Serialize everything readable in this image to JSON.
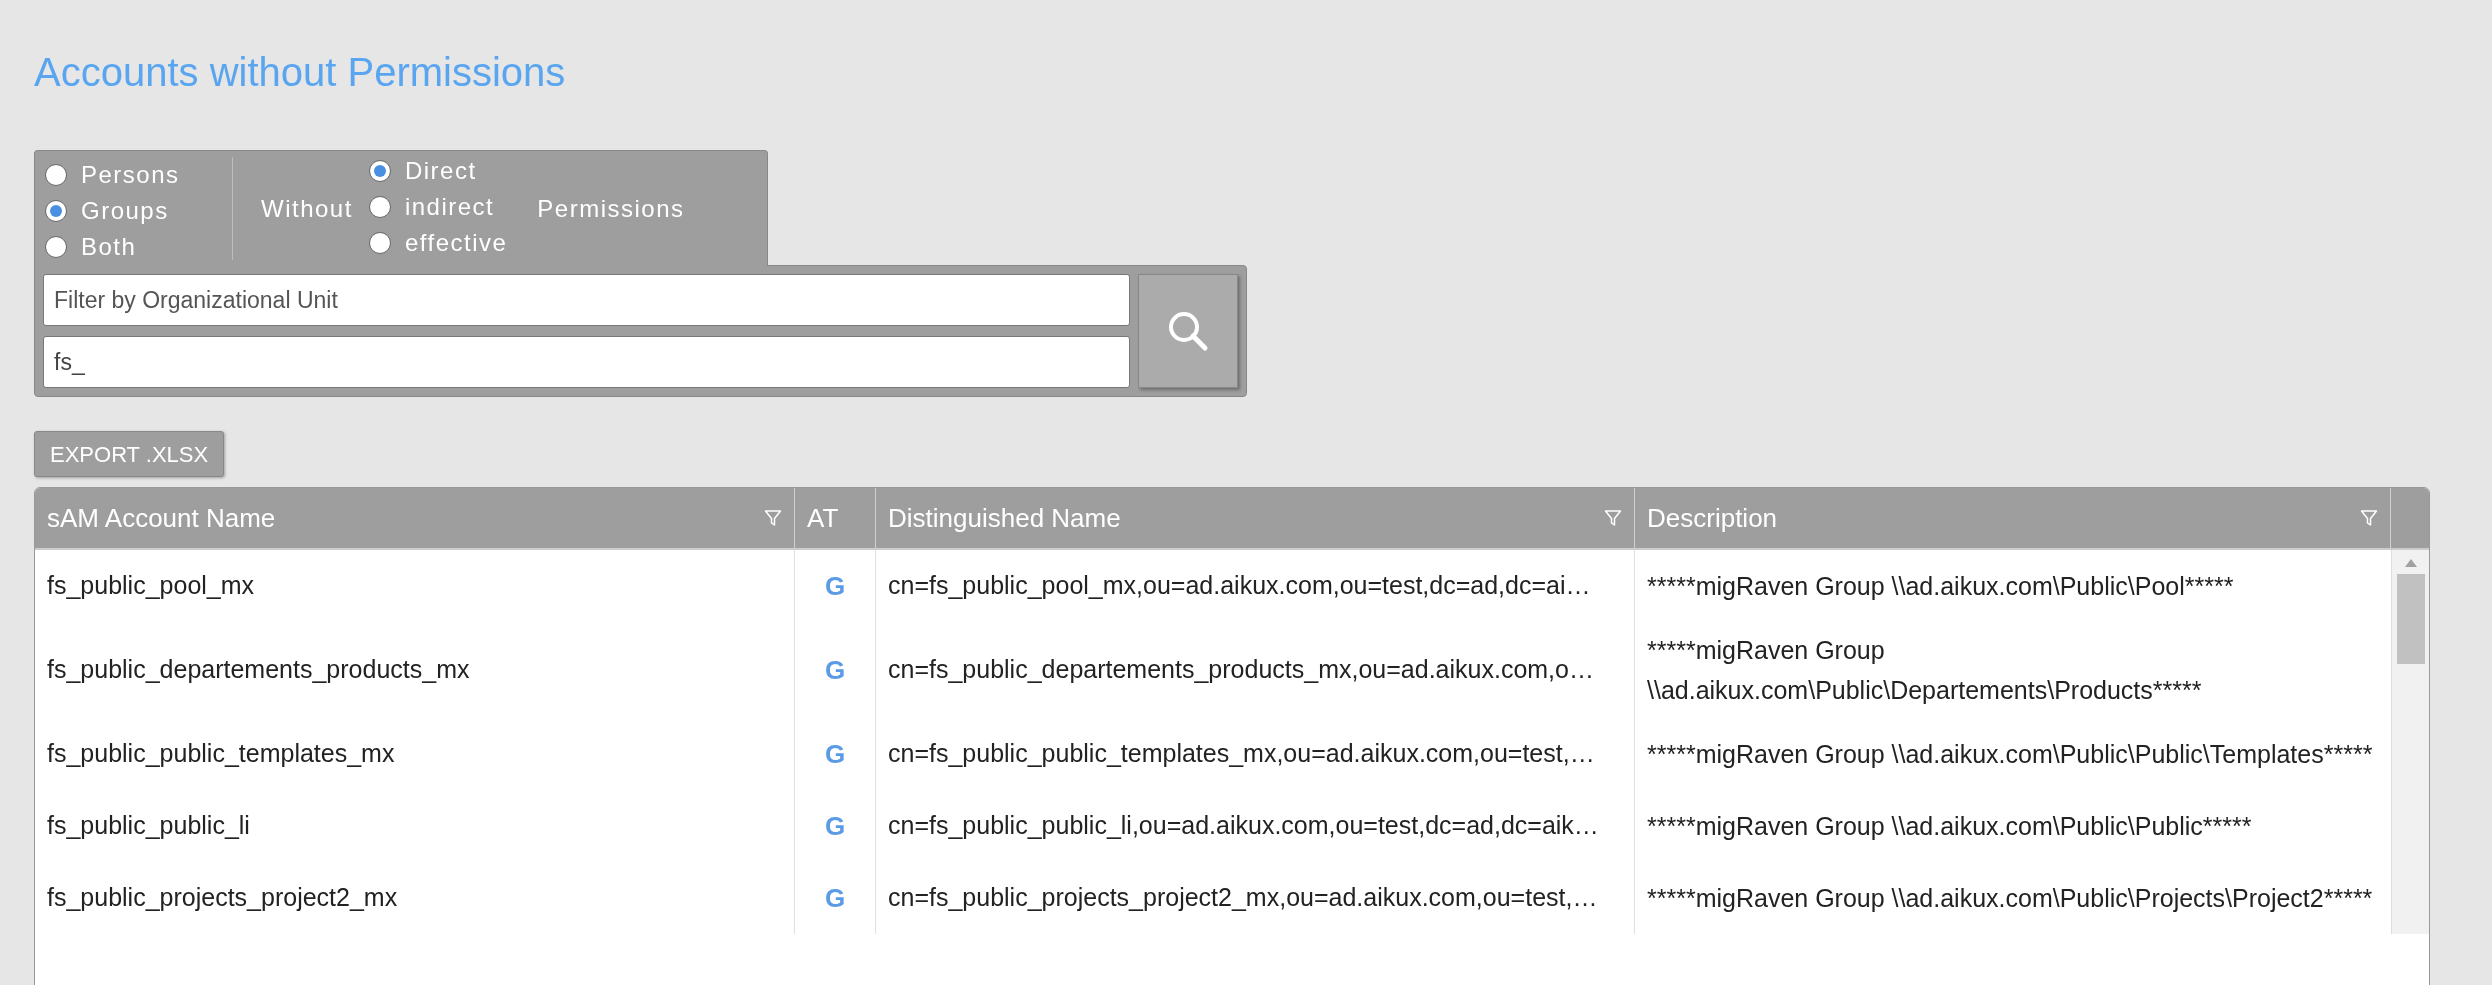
{
  "title": "Accounts without Permissions",
  "account_types": [
    {
      "label": "Persons",
      "selected": false
    },
    {
      "label": "Groups",
      "selected": true
    },
    {
      "label": "Both",
      "selected": false
    }
  ],
  "without_label": "Without",
  "permission_types": [
    {
      "label": "Direct",
      "selected": true
    },
    {
      "label": "indirect",
      "selected": false
    },
    {
      "label": "effective",
      "selected": false
    }
  ],
  "permissions_label": "Permissions",
  "ou_filter": {
    "placeholder": "Filter by Organizational Unit"
  },
  "name_filter": {
    "value": "fs_"
  },
  "export_button": "EXPORT .XLSX",
  "table": {
    "columns": [
      {
        "label": "sAM Account Name",
        "filter": true
      },
      {
        "label": "AT",
        "filter": false
      },
      {
        "label": "Distinguished Name",
        "filter": true
      },
      {
        "label": "Description",
        "filter": true
      }
    ],
    "rows": [
      {
        "sam": "fs_public_pool_mx",
        "at": "G",
        "dn": "cn=fs_public_pool_mx,ou=ad.aikux.com,ou=test,dc=ad,dc=ai…",
        "description": "*****migRaven Group \\\\ad.aikux.com\\Public\\Pool*****"
      },
      {
        "sam": "fs_public_departements_products_mx",
        "at": "G",
        "dn": "cn=fs_public_departements_products_mx,ou=ad.aikux.com,o…",
        "description": "*****migRaven Group \\\\ad.aikux.com\\Public\\Departements\\Products*****"
      },
      {
        "sam": "fs_public_public_templates_mx",
        "at": "G",
        "dn": "cn=fs_public_public_templates_mx,ou=ad.aikux.com,ou=test,…",
        "description": "*****migRaven Group \\\\ad.aikux.com\\Public\\Public\\Templates*****"
      },
      {
        "sam": "fs_public_public_li",
        "at": "G",
        "dn": "cn=fs_public_public_li,ou=ad.aikux.com,ou=test,dc=ad,dc=aik…",
        "description": "*****migRaven Group \\\\ad.aikux.com\\Public\\Public*****"
      },
      {
        "sam": "fs_public_projects_project2_mx",
        "at": "G",
        "dn": "cn=fs_public_projects_project2_mx,ou=ad.aikux.com,ou=test,…",
        "description": "*****migRaven Group \\\\ad.aikux.com\\Public\\Projects\\Project2*****"
      }
    ]
  }
}
